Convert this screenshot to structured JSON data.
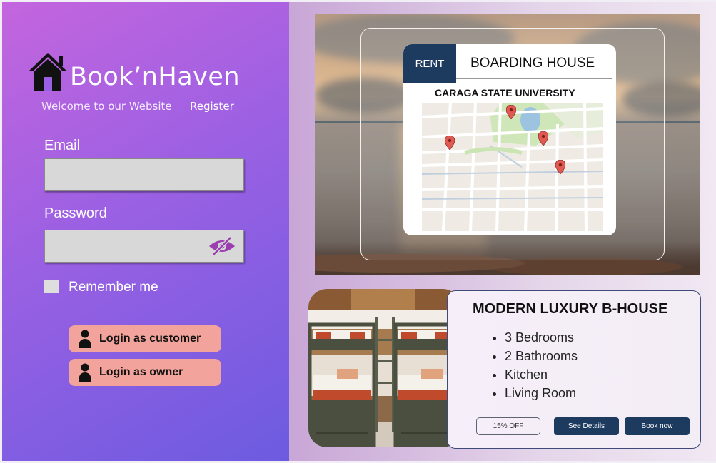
{
  "brand": {
    "name": "Book’nHaven",
    "welcome": "Welcome to our Website",
    "register": "Register"
  },
  "form": {
    "email_label": "Email",
    "email_value": "",
    "password_label": "Password",
    "password_value": "",
    "remember_label": "Remember me",
    "remember_checked": false
  },
  "buttons": {
    "login_customer": "Login as customer",
    "login_owner": "Login as owner"
  },
  "featured": {
    "tab_rent": "RENT",
    "tab_title": "BOARDING HOUSE",
    "location": "CARAGA STATE UNIVERSITY"
  },
  "listing": {
    "title": "MODERN LUXURY B-HOUSE",
    "features": [
      "3 Bedrooms",
      "2 Bathrooms",
      "Kitchen",
      "Living Room"
    ],
    "discount": "15% OFF",
    "see_details": "See Details",
    "book_now": "Book now"
  },
  "colors": {
    "accent_dark": "#1d3a5f",
    "login_button": "#f2a39b",
    "left_gradient_start": "#c465de",
    "left_gradient_end": "#6c5be0",
    "map_pin": "#e05a52"
  },
  "icons": [
    "house-logo-icon",
    "eye-off-icon",
    "person-icon",
    "map-pin-icon"
  ]
}
